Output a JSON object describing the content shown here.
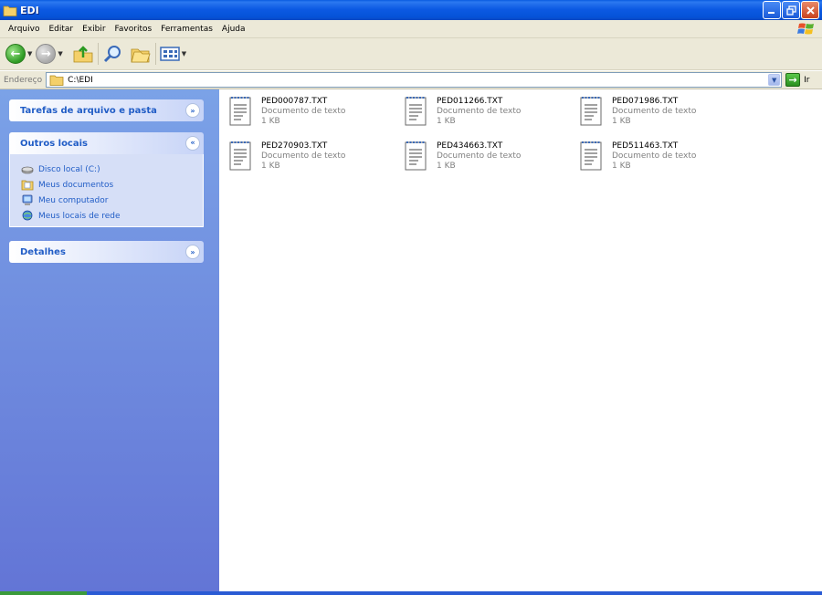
{
  "window": {
    "title": "EDI"
  },
  "menu": [
    "Arquivo",
    "Editar",
    "Exibir",
    "Favoritos",
    "Ferramentas",
    "Ajuda"
  ],
  "address": {
    "label": "Endereço",
    "value": "C:\\EDI",
    "go_label": "Ir"
  },
  "taskpane": {
    "file_tasks_title": "Tarefas de arquivo e pasta",
    "other_places_title": "Outros locais",
    "other_places": [
      {
        "label": "Disco local (C:)",
        "icon": "drive-icon"
      },
      {
        "label": "Meus documentos",
        "icon": "my-documents-icon"
      },
      {
        "label": "Meu computador",
        "icon": "my-computer-icon"
      },
      {
        "label": "Meus locais de rede",
        "icon": "network-places-icon"
      }
    ],
    "details_title": "Detalhes"
  },
  "files": [
    {
      "name": "PED000787.TXT",
      "type": "Documento de texto",
      "size": "1 KB"
    },
    {
      "name": "PED011266.TXT",
      "type": "Documento de texto",
      "size": "1 KB"
    },
    {
      "name": "PED071986.TXT",
      "type": "Documento de texto",
      "size": "1 KB"
    },
    {
      "name": "PED270903.TXT",
      "type": "Documento de texto",
      "size": "1 KB"
    },
    {
      "name": "PED434663.TXT",
      "type": "Documento de texto",
      "size": "1 KB"
    },
    {
      "name": "PED511463.TXT",
      "type": "Documento de texto",
      "size": "1 KB"
    }
  ],
  "colors": {
    "titlebar": "#0a5be0",
    "taskpane_top": "#7ba2e7",
    "taskpane_bottom": "#6375d6",
    "link": "#215dc6"
  }
}
